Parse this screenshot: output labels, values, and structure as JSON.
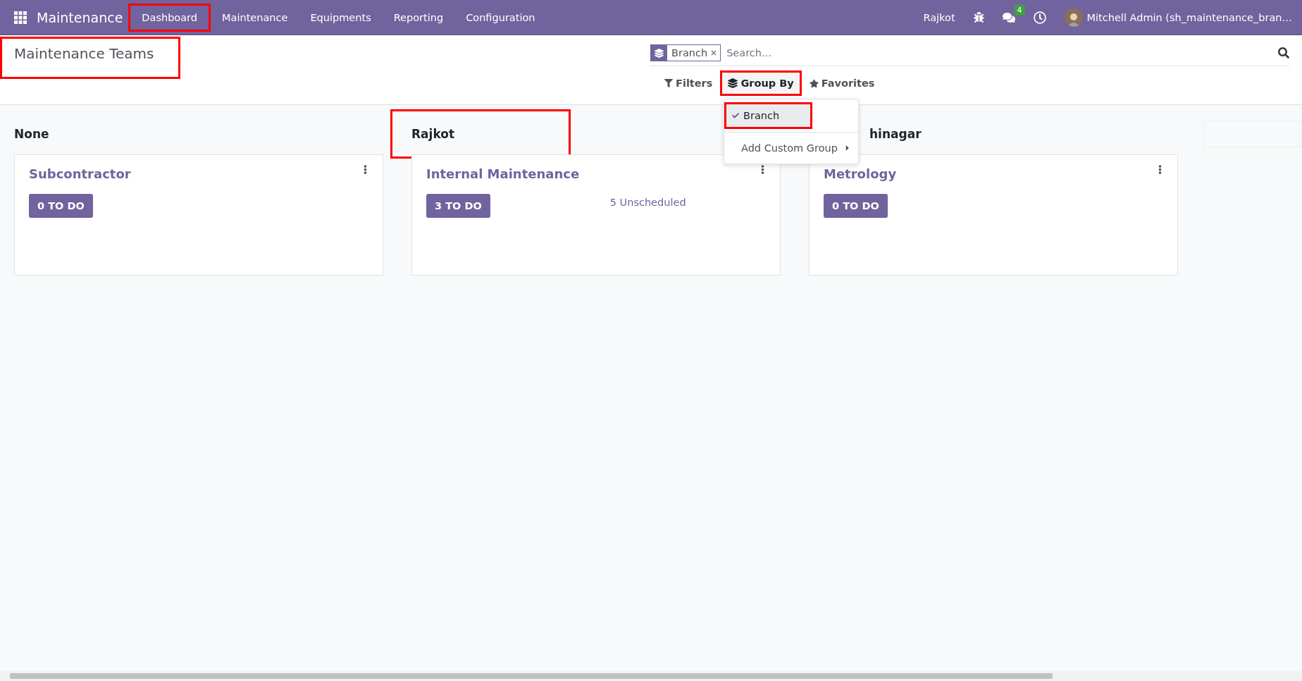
{
  "navbar": {
    "app_name": "Maintenance",
    "menu": [
      {
        "label": "Dashboard",
        "highlighted": true
      },
      {
        "label": "Maintenance",
        "highlighted": false
      },
      {
        "label": "Equipments",
        "highlighted": false
      },
      {
        "label": "Reporting",
        "highlighted": false
      },
      {
        "label": "Configuration",
        "highlighted": false
      }
    ],
    "branch": "Rajkot",
    "messages_badge": "4",
    "user": "Mitchell Admin (sh_maintenance_bran…"
  },
  "page_title": {
    "text": "Maintenance Teams",
    "highlighted": true
  },
  "search": {
    "facet": "Branch",
    "placeholder": "Search..."
  },
  "search_options": [
    {
      "label": "Filters",
      "kind": "filter",
      "open": false,
      "highlighted": false
    },
    {
      "label": "Group By",
      "kind": "group",
      "open": true,
      "highlighted": true
    },
    {
      "label": "Favorites",
      "kind": "star",
      "open": false,
      "highlighted": false
    }
  ],
  "group_by_menu": {
    "items": [
      {
        "label": "Branch",
        "checked": true,
        "highlighted": true
      }
    ],
    "custom": "Add Custom Group"
  },
  "columns": [
    {
      "title": "None",
      "highlighted": false,
      "cards": [
        {
          "name": "Subcontractor",
          "todo": "0 TO DO"
        }
      ]
    },
    {
      "title": "Rajkot",
      "highlighted": true,
      "cards": [
        {
          "name": "Internal Maintenance",
          "todo": "3 TO DO",
          "unscheduled": "5 Unscheduled"
        }
      ]
    },
    {
      "title": "hinagar",
      "highlighted": false,
      "cards": [
        {
          "name": "Metrology",
          "todo": "0 TO DO"
        }
      ]
    }
  ]
}
